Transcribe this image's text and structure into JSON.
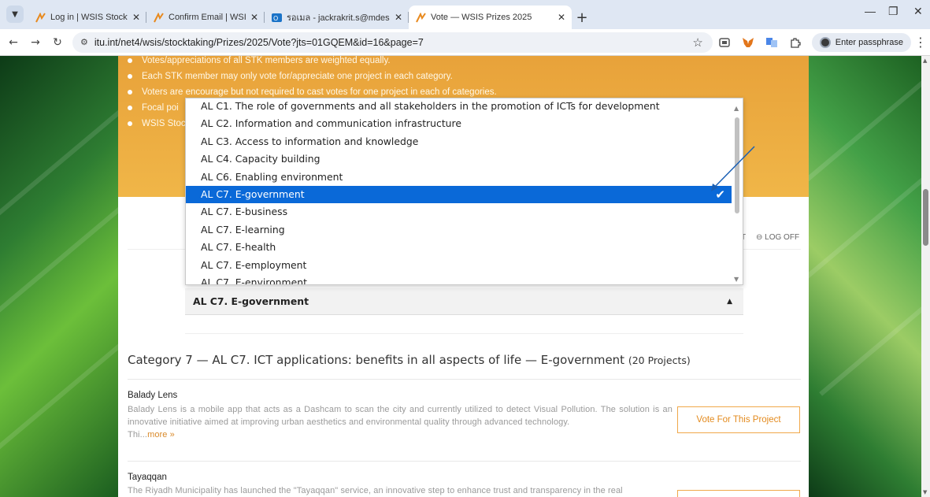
{
  "browser": {
    "tabs": [
      {
        "title": "Log in | WSIS Stocktaking Platfo",
        "active": false
      },
      {
        "title": "Confirm Email | WSIS Stocktakir",
        "active": false
      },
      {
        "title": "รอเมล - jackrakrit.s@mdes.go",
        "active": false
      },
      {
        "title": "Vote — WSIS Prizes 2025",
        "active": true
      }
    ],
    "new_tab": "+",
    "url": "itu.int/net4/wsis/stocktaking/Prizes/2025/Vote?jts=01GQEM&id=16&page=7",
    "passphrase_button": "Enter passphrase"
  },
  "rules": [
    "Votes/appreciations of all STK members are weighted equally.",
    "Each STK member may only vote for/appreciate one project in each category.",
    "Voters are encourage but not required to cast votes for one project in each of categories.",
    "Focal poi",
    "WSIS Stoc"
  ],
  "dropdown": {
    "options": [
      "AL C1. The role of governments and all stakeholders in the promotion of ICTs for development",
      "AL C2. Information and communication infrastructure",
      "AL C3. Access to information and knowledge",
      "AL C4. Capacity building",
      "AL C6. Enabling environment",
      "AL C7. E-government",
      "AL C7. E-business",
      "AL C7. E-learning",
      "AL C7. E-health",
      "AL C7. E-employment",
      "AL C7. E-environment"
    ],
    "selected_index": 5,
    "selected_label": "AL C7. E-government"
  },
  "header": {
    "partial_left": "T",
    "log_off": "⊖ LOG OFF"
  },
  "category": {
    "heading": "Category 7 — AL C7. ICT applications: benefits in all aspects of life — E-government",
    "count": "(20 Projects)"
  },
  "projects": [
    {
      "title": "Balady Lens",
      "description": "Balady Lens is a mobile app that acts as a Dashcam to scan the city and currently utilized to detect Visual Pollution. The solution is an innovative initiative aimed at improving urban aesthetics and environmental quality through advanced technology.",
      "tail": "Thi...",
      "more": "more »",
      "vote_label": "Vote For This Project"
    },
    {
      "title": "Tayaqqan",
      "description": "The Riyadh Municipality has launched the \"Tayaqqan\" service, an innovative step to enhance trust and transparency in the real",
      "vote_label": ""
    }
  ]
}
